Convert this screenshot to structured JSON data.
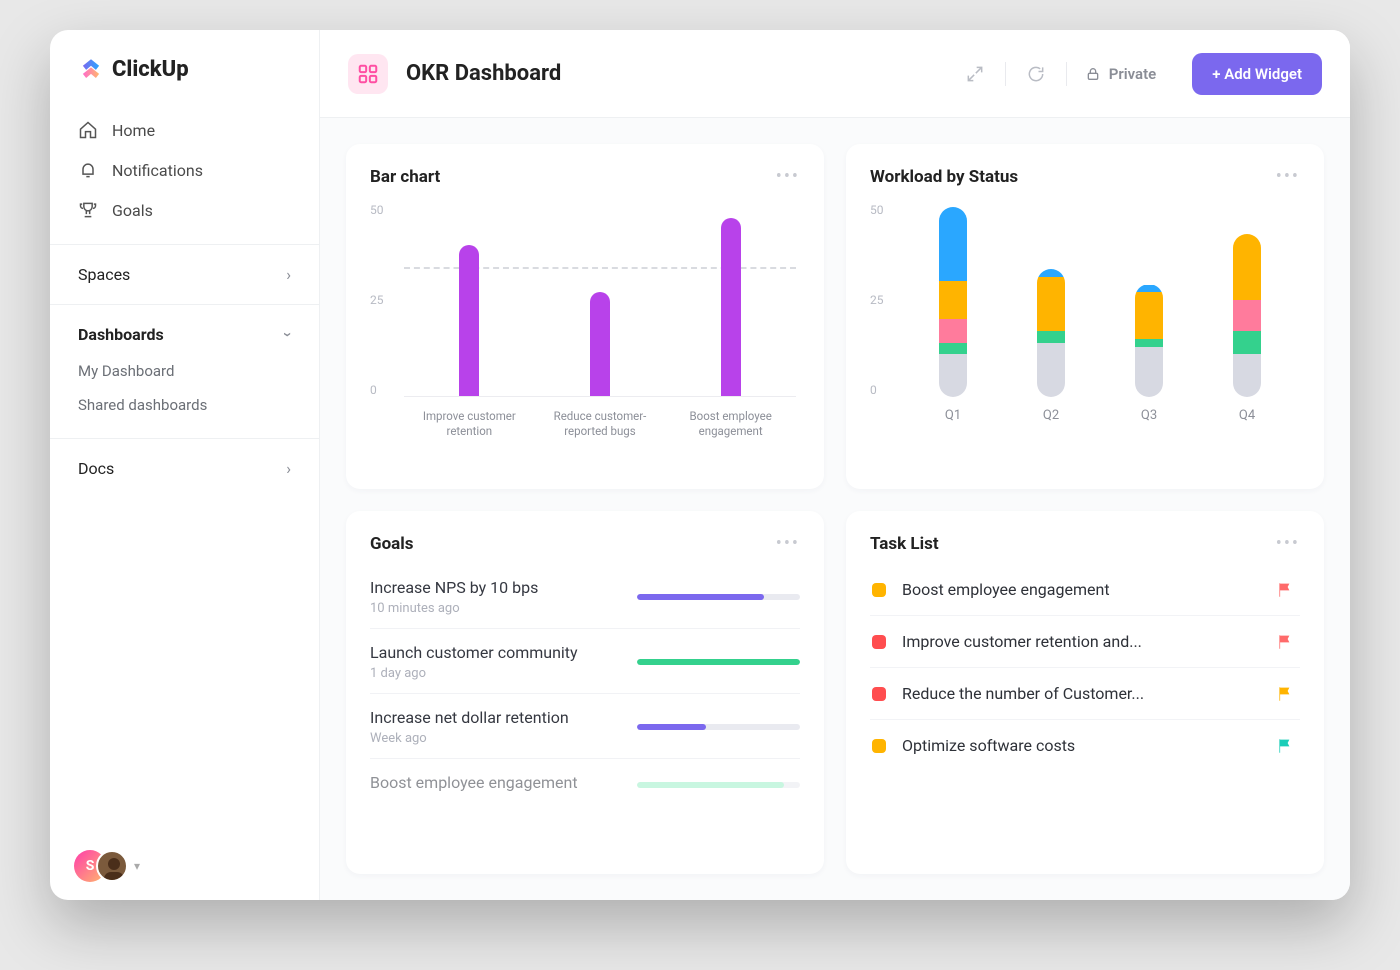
{
  "brand": "ClickUp",
  "nav": {
    "home": "Home",
    "notifications": "Notifications",
    "goals": "Goals"
  },
  "sections": {
    "spaces": "Spaces",
    "dashboards": {
      "label": "Dashboards",
      "items": [
        "My Dashboard",
        "Shared dashboards"
      ]
    },
    "docs": "Docs"
  },
  "header": {
    "title": "OKR Dashboard",
    "privacy": "Private",
    "addWidget": "+ Add Widget"
  },
  "widgets": {
    "bar": {
      "title": "Bar chart"
    },
    "stack": {
      "title": "Workload by Status"
    },
    "goals": {
      "title": "Goals",
      "items": [
        {
          "title": "Increase NPS by 10 bps",
          "time": "10 minutes ago",
          "pct": 78,
          "color": "#7b68ee"
        },
        {
          "title": "Launch customer community",
          "time": "1 day ago",
          "pct": 100,
          "color": "#34d18d"
        },
        {
          "title": "Increase net dollar retention",
          "time": "Week ago",
          "pct": 42,
          "color": "#7b68ee"
        },
        {
          "title": "Boost employee engagement",
          "time": "",
          "pct": 90,
          "color": "#9cf0c8"
        }
      ]
    },
    "tasks": {
      "title": "Task List",
      "items": [
        {
          "status": "#ffb400",
          "name": "Boost employee engagement",
          "flag": "#ff6b6b"
        },
        {
          "status": "#ff4d4f",
          "name": "Improve customer retention and...",
          "flag": "#ff6b6b"
        },
        {
          "status": "#ff4d4f",
          "name": "Reduce the number of Customer...",
          "flag": "#ffb400"
        },
        {
          "status": "#ffb400",
          "name": "Optimize software costs",
          "flag": "#1bcdb8"
        }
      ]
    }
  },
  "chart_data": [
    {
      "id": "bar",
      "type": "bar",
      "title": "Bar chart",
      "ylim": [
        0,
        50
      ],
      "yticks": [
        0,
        25,
        50
      ],
      "reference_line": 33,
      "categories": [
        "Improve customer retention",
        "Reduce customer-reported bugs",
        "Boost employee engagement"
      ],
      "values": [
        39,
        27,
        46
      ],
      "color": "#b842ea"
    },
    {
      "id": "stack",
      "type": "stacked-bar",
      "title": "Workload by Status",
      "ylim": [
        0,
        50
      ],
      "yticks": [
        0,
        25,
        50
      ],
      "categories": [
        "Q1",
        "Q2",
        "Q3",
        "Q4"
      ],
      "segment_order": [
        "gray",
        "green",
        "pink",
        "yellow",
        "blue"
      ],
      "colors": {
        "gray": "#d7d9e2",
        "green": "#34d18d",
        "pink": "#ff7b9c",
        "yellow": "#ffb400",
        "blue": "#2aa7ff"
      },
      "series": [
        {
          "name": "Q1",
          "gray": 11,
          "green": 3,
          "pink": 6,
          "yellow": 10,
          "blue": 19
        },
        {
          "name": "Q2",
          "gray": 14,
          "green": 3,
          "pink": 0,
          "yellow": 14,
          "blue": 2
        },
        {
          "name": "Q3",
          "gray": 13,
          "green": 2,
          "pink": 0,
          "yellow": 12,
          "blue": 2
        },
        {
          "name": "Q4",
          "gray": 11,
          "green": 6,
          "pink": 8,
          "yellow": 17,
          "blue": 0
        }
      ]
    }
  ],
  "user_avatar_letter": "S"
}
